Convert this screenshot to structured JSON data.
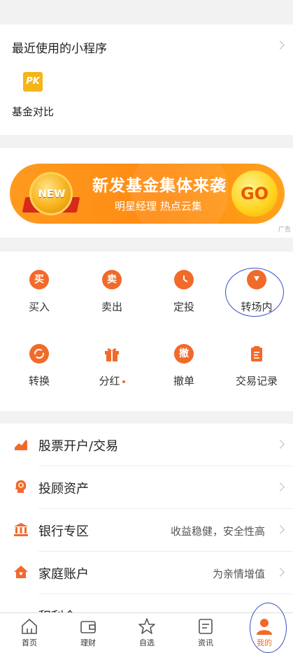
{
  "recent": {
    "title": "最近使用的小程序",
    "app_icon_text": "PK",
    "app_label": "基金对比"
  },
  "banner": {
    "medal_text": "NEW",
    "title": "新发基金集体来袭",
    "subtitle": "明星经理 热点云集",
    "go_label": "GO",
    "ad_label": "广告"
  },
  "actions": [
    {
      "label": "买入",
      "icon": "buy-icon",
      "glyph": "买"
    },
    {
      "label": "卖出",
      "icon": "sell-icon",
      "glyph": "卖"
    },
    {
      "label": "定投",
      "icon": "clock-icon",
      "glyph": ""
    },
    {
      "label": "转场内",
      "icon": "transfer-in-icon",
      "glyph": ""
    },
    {
      "label": "转换",
      "icon": "convert-icon",
      "glyph": ""
    },
    {
      "label": "分红",
      "icon": "gift-icon",
      "glyph": ""
    },
    {
      "label": "撤单",
      "icon": "cancel-order-icon",
      "glyph": "撤"
    },
    {
      "label": "交易记录",
      "icon": "record-icon",
      "glyph": ""
    }
  ],
  "list": [
    {
      "label": "股票开户/交易",
      "right": "",
      "icon": "stock-chart-icon"
    },
    {
      "label": "投顾资产",
      "right": "",
      "icon": "advisor-icon"
    },
    {
      "label": "银行专区",
      "right": "收益稳健，安全性高",
      "icon": "bank-icon"
    },
    {
      "label": "家庭账户",
      "right": "为亲情增值",
      "icon": "home-icon"
    },
    {
      "label": "积利金",
      "right": "",
      "icon": "gold-icon"
    }
  ],
  "tabs": [
    {
      "label": "首页",
      "icon": "home-tab-icon"
    },
    {
      "label": "理财",
      "icon": "wallet-icon"
    },
    {
      "label": "自选",
      "icon": "star-icon"
    },
    {
      "label": "资讯",
      "icon": "news-icon"
    },
    {
      "label": "我的",
      "icon": "user-icon"
    }
  ],
  "colors": {
    "accent": "#f16a2a",
    "annotation": "#3a4fc7"
  }
}
